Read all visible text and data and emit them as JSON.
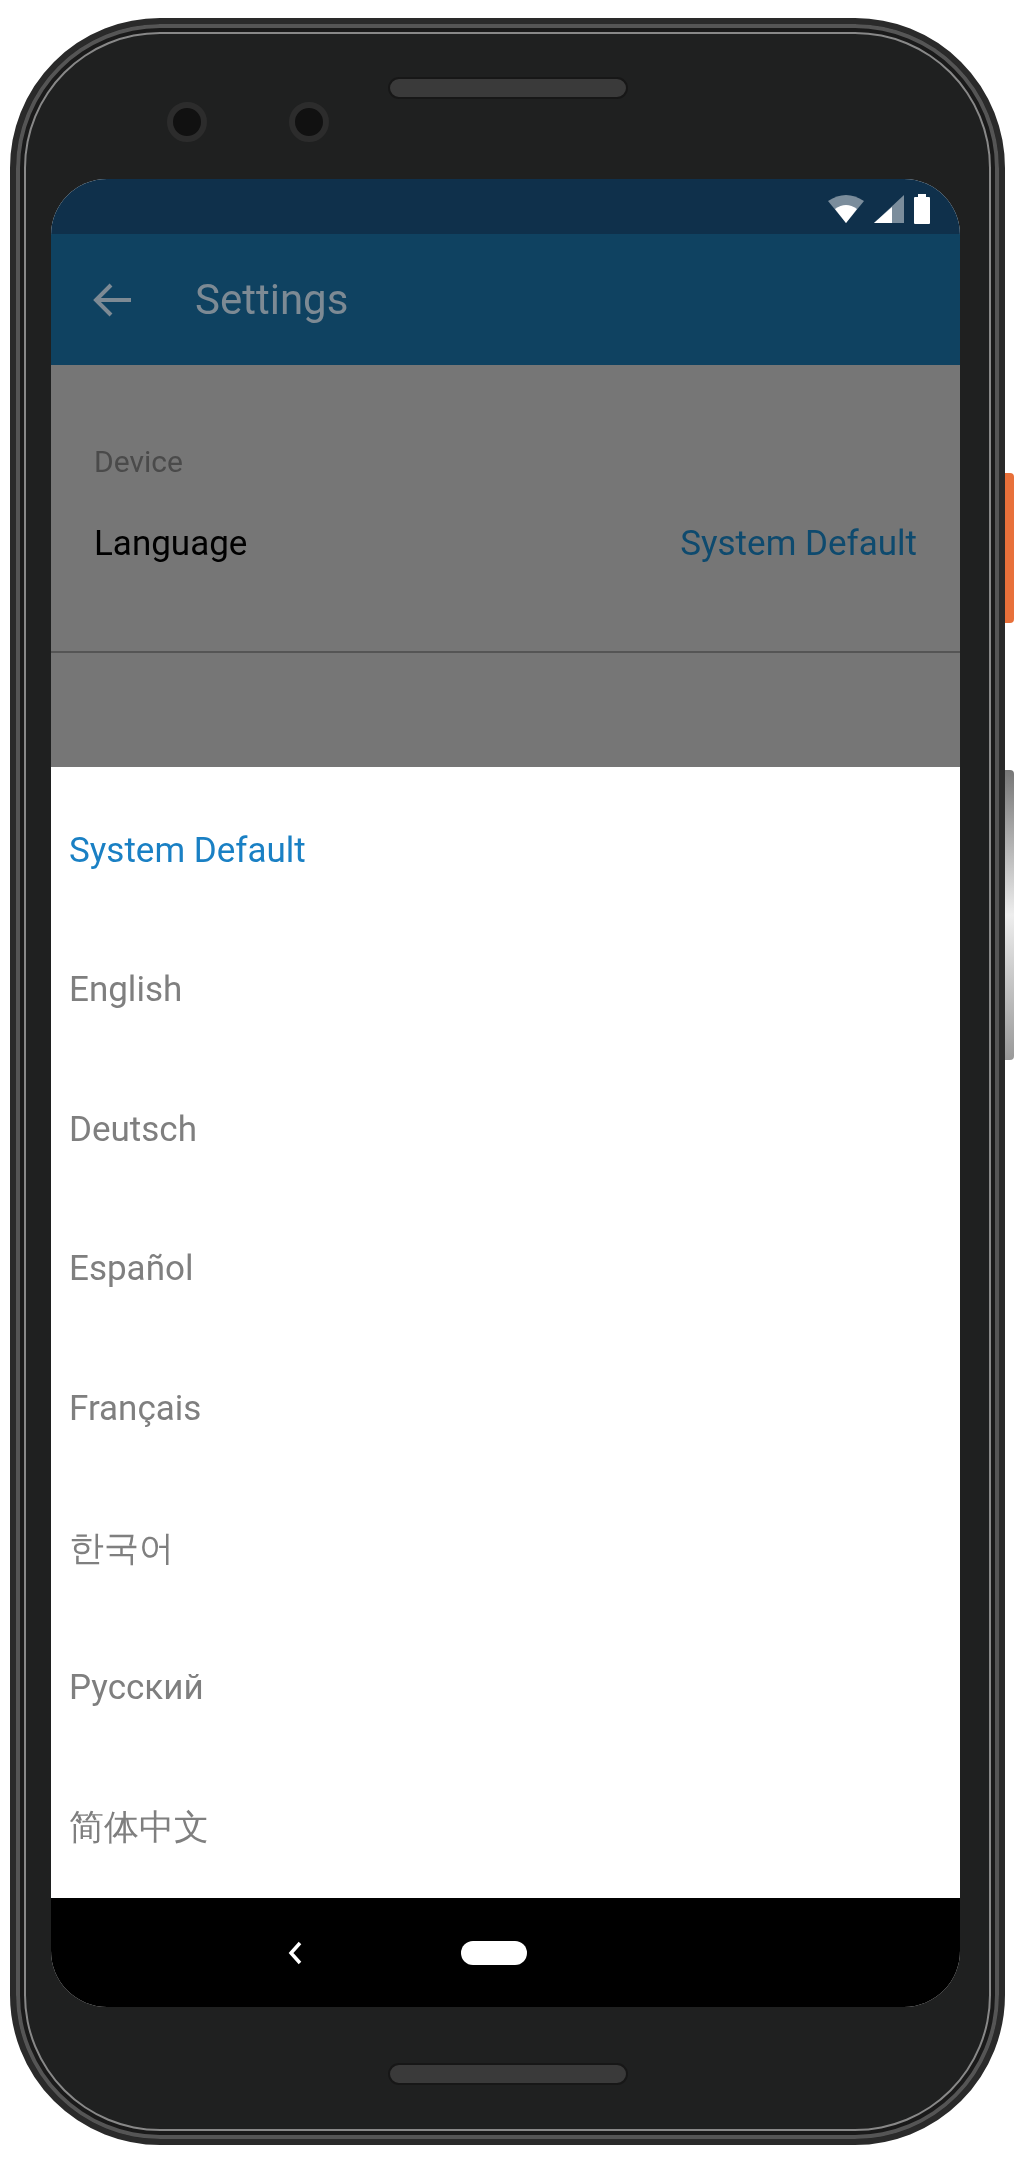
{
  "app_bar": {
    "title": "Settings"
  },
  "settings": {
    "section": "Device",
    "row": {
      "label": "Language",
      "value": "System Default"
    }
  },
  "language_options": [
    {
      "label": "System Default",
      "selected": true
    },
    {
      "label": "English",
      "selected": false
    },
    {
      "label": "Deutsch",
      "selected": false
    },
    {
      "label": "Español",
      "selected": false
    },
    {
      "label": "Français",
      "selected": false
    },
    {
      "label": "한국어",
      "selected": false
    },
    {
      "label": "Русский",
      "selected": false
    },
    {
      "label": "简体中文",
      "selected": false
    }
  ]
}
